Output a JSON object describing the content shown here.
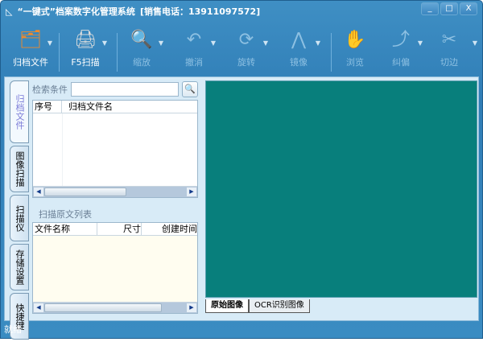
{
  "window": {
    "title": "“一键式”档案数字化管理系统",
    "phone": "[销售电话：13911097572]",
    "buttons": [
      "_",
      "□",
      "X"
    ]
  },
  "toolbar": [
    {
      "label": "归档文件",
      "icon": "folder-document-icon",
      "enabled": true
    },
    {
      "label": "F5扫描",
      "icon": "scanner-icon",
      "enabled": true
    },
    {
      "label": "缩放",
      "icon": "zoom-icon",
      "enabled": false
    },
    {
      "label": "撤消",
      "icon": "undo-icon",
      "enabled": false
    },
    {
      "label": "旋转",
      "icon": "rotate-icon",
      "enabled": false
    },
    {
      "label": "镜像",
      "icon": "mirror-icon",
      "enabled": false
    },
    {
      "label": "浏览",
      "icon": "hand-icon",
      "enabled": false
    },
    {
      "label": "纠偏",
      "icon": "deskew-icon",
      "enabled": false
    },
    {
      "label": "切边",
      "icon": "scissors-icon",
      "enabled": false
    }
  ],
  "side_tabs": [
    "归档文件",
    "图像扫描",
    "扫描仪",
    "存储设置",
    "快捷键"
  ],
  "search": {
    "label": "检索条件",
    "value": ""
  },
  "archive_table": {
    "columns": [
      "序号",
      "归档文件名"
    ]
  },
  "scan_list": {
    "title": "扫描原文列表",
    "columns": [
      "文件名称",
      "尺寸",
      "创建时间"
    ]
  },
  "view_tabs": [
    "原始图像",
    "OCR识别图像"
  ],
  "status": "就绪",
  "colors": {
    "canvas": "#087f7c",
    "frame": "#3a8cc2"
  }
}
